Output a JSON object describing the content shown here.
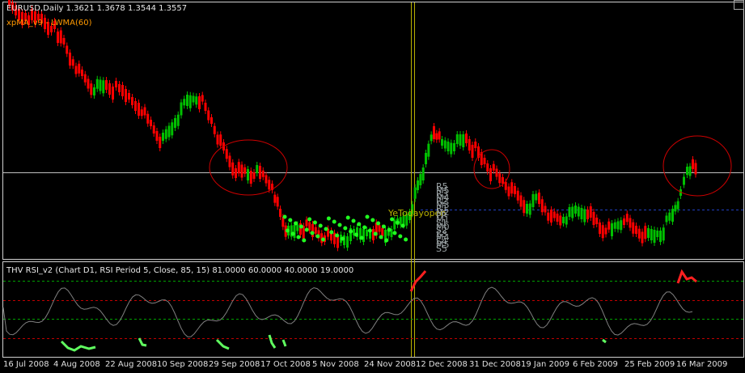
{
  "chart": {
    "symbol_header": "EURUSD,Daily  1.3621 1.3678 1.3544 1.3557",
    "indicator_label": "xpMA_v9 - LWMA(60)",
    "subwindow_header": "THV RSI_v2  (Chart D1,  RSI Period 5,  Close,  85,  15)  81.0000 60.0000 40.0000 19.0000",
    "overlay_label": "YeTodayopen",
    "pivot_labels": [
      "R5",
      "M5",
      "R3",
      "M4",
      "R2",
      "M3",
      "R1",
      "M2",
      "PP",
      "M1",
      "S1",
      "M0",
      "S2",
      "S3",
      "M4",
      "S4",
      "M5",
      "S5"
    ],
    "colors": {
      "background": "#000000",
      "bull": "#00c000",
      "bear": "#ff0000",
      "grid": "#c0c0c0",
      "rsi_line": "#808080",
      "level_green": "#00a000",
      "level_red": "#c00000",
      "cursor_line": "#b8b000",
      "circle": "#cc0000"
    }
  },
  "xaxis": {
    "labels": [
      "16 Jul 2008",
      "4 Aug 2008",
      "22 Aug 2008",
      "10 Sep 2008",
      "29 Sep 2008",
      "17 Oct 2008",
      "5 Nov 2008",
      "24 Nov 2008",
      "12 Dec 2008",
      "31 Dec 2008",
      "19 Jan 2009",
      "6 Feb 2009",
      "25 Feb 2009",
      "16 Mar 2009"
    ]
  },
  "chart_data": {
    "type": "candlestick",
    "title": "EURUSD,Daily",
    "ohlc_current": {
      "open": 1.3621,
      "high": 1.3678,
      "low": 1.3544,
      "close": 1.3557
    },
    "x": [
      "16 Jul 2008",
      "4 Aug 2008",
      "22 Aug 2008",
      "10 Sep 2008",
      "29 Sep 2008",
      "17 Oct 2008",
      "5 Nov 2008",
      "24 Nov 2008",
      "12 Dec 2008",
      "31 Dec 2008",
      "19 Jan 2009",
      "6 Feb 2009",
      "25 Feb 2009",
      "16 Mar 2009"
    ],
    "rsi_levels": [
      81.0,
      60.0,
      40.0,
      19.0
    ]
  }
}
